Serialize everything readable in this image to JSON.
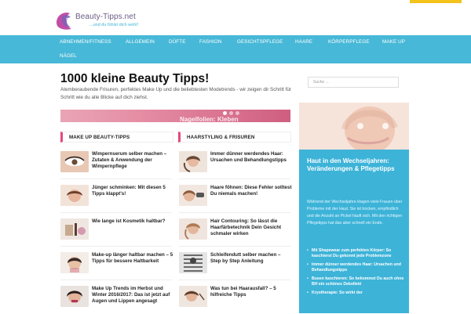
{
  "site": {
    "name": "Beauty-Tipps.net",
    "tagline": "...und du fühlst dich wohl!"
  },
  "nav": {
    "items": [
      "ABNEHMEN/FITNESS",
      "ALLGEMEIN",
      "DÜFTE",
      "FASHION",
      "GESICHTSPFLEGE",
      "HAARE",
      "KÖRPERPFLEGE",
      "MAKE UP",
      "NÄGEL"
    ]
  },
  "main": {
    "title": "1000 kleine Beauty Tipps!",
    "intro": "Atemberaubende Frisuren, perfektes Make Up und die beliebtesten Modetrends - wir zeigen dir Schritt für Schritt wie du alle Blicke auf dich ziehst.",
    "hero_caption": "Nagelfolien: Kleben"
  },
  "sections": {
    "left": {
      "title": "MAKE UP BEAUTY-TIPPS",
      "posts": [
        {
          "title": "Wimpernserum selber machen – Zutaten & Anwendung der Wimpernpflege"
        },
        {
          "title": "Jünger schminken: Mit diesen 5 Tipps klappt's!"
        },
        {
          "title": "Wie lange ist Kosmetik haltbar?"
        },
        {
          "title": "Make-up länger haltbar machen – 5 Tipps für bessere Haltbarkeit"
        },
        {
          "title": "Make Up Trends im Herbst und Winter 2016/2017: Das ist jetzt auf Augen und Lippen angesagt"
        }
      ]
    },
    "right": {
      "title": "HAARSTYLING & FRISUREN",
      "posts": [
        {
          "title": "Immer dünner werdendes Haar: Ursachen und Behandlungstipps"
        },
        {
          "title": "Haare föhnen: Diese Fehler solltest Du niemals machen!"
        },
        {
          "title": "Hair Contouring: So lässt die Haarfärbetechnik Dein Gesicht schmaler wirken"
        },
        {
          "title": "Schleifendutt selber machen – Step by Step Anleitung"
        },
        {
          "title": "Was tun bei Haarausfall? – 5 hilfreiche Tipps"
        }
      ]
    }
  },
  "sidebar": {
    "search_placeholder": "Suche ...",
    "promo_title": "Haut in den Wechseljahren: Veränderungen & Pflegetipps",
    "promo_text": "Während der Wechseljahre klagen viele Frauen über Probleme mit der Haut. Sie ist trocken, empfindlich und die Anzahl an Pickel häuft sich. Mit den richtigen Pflegetipps hat das aber schnell ein Ende.",
    "links": [
      "Mit Shapewear zum perfekten Körper: So kaschierst Du gekonnt jede Problemzone",
      "Immer dünner werdendes Haar: Ursachen und Behandlungstipps",
      "Busen kaschieren: So bekommst Du auch ohne BH ein schönes Dekolleté",
      "Kryotherapie: So wirkt der"
    ]
  },
  "colors": {
    "nav_bg": "#47b8d7",
    "accent_pink": "#e24a79",
    "promo_bg": "#3db3d8"
  }
}
